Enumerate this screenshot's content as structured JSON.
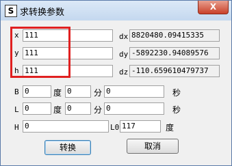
{
  "window": {
    "title": "求转换参数",
    "app_icon_glyph": "S",
    "close_glyph": "X"
  },
  "inputs": {
    "x": {
      "label": "x",
      "value": "111"
    },
    "y": {
      "label": "y",
      "value": "111"
    },
    "h": {
      "label": "h",
      "value": "111"
    }
  },
  "outputs": {
    "dx": {
      "label": "dx",
      "value": "8820480.09415335"
    },
    "dy": {
      "label": "dy",
      "value": "-5892230.94089576"
    },
    "dz": {
      "label": "dz",
      "value": "-110.659610479737"
    }
  },
  "b_row": {
    "label": "B",
    "deg": "0",
    "deg_unit": "度",
    "min": "0",
    "min_unit": "分",
    "sec": "0",
    "sec_unit": "秒"
  },
  "l_row": {
    "label": "L",
    "deg": "0",
    "deg_unit": "度",
    "min": "0",
    "min_unit": "分",
    "sec": "0",
    "sec_unit": "秒"
  },
  "h_row": {
    "label": "H",
    "value": "0",
    "l0_label": "L0",
    "l0_value": "117",
    "l0_unit": "度"
  },
  "buttons": {
    "convert": "转换",
    "cancel": "取消"
  }
}
